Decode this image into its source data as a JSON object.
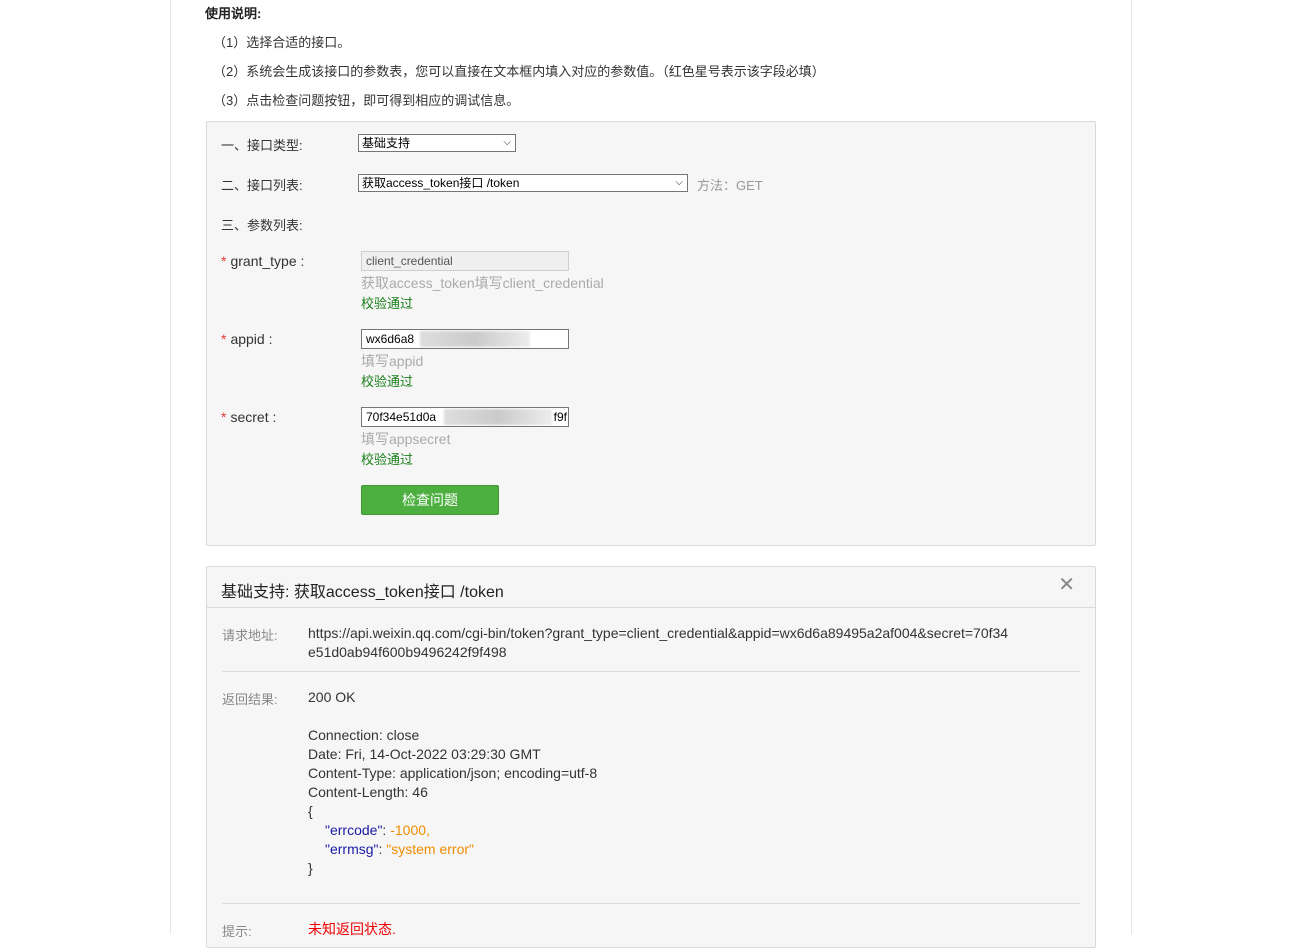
{
  "instructions": {
    "title": "使用说明:",
    "steps": [
      "（1）选择合适的接口。",
      "（2）系统会生成该接口的参数表，您可以直接在文本框内填入对应的参数值。（红色星号表示该字段必填）",
      "（3）点击检查问题按钮，即可得到相应的调试信息。"
    ]
  },
  "form": {
    "interface_type_label": "一、接口类型:",
    "interface_type_value": "基础支持",
    "interface_list_label": "二、接口列表:",
    "interface_list_value": "获取access_token接口 /token",
    "method_text": "方法：GET",
    "params_label": "三、参数列表:",
    "required_mark": "*",
    "params": [
      {
        "name": "grant_type :",
        "value": "client_credential",
        "hint": "获取access_token填写client_credential",
        "status": "校验通过",
        "disabled": true
      },
      {
        "name": "appid :",
        "value": "wx6d6a8",
        "hint": "填写appid",
        "status": "校验通过",
        "disabled": false
      },
      {
        "name": "secret :",
        "value": "70f34e51d0a",
        "value_suffix": "f9f",
        "hint": "填写appsecret",
        "status": "校验通过",
        "disabled": false
      }
    ],
    "check_button": "检查问题"
  },
  "result": {
    "title": "基础支持: 获取access_token接口 /token",
    "close_icon": "close-icon",
    "request_label": "请求地址:",
    "request_url_line1": "https://api.weixin.qq.com/cgi-bin/token?grant_type=client_credential&appid=wx6d6a89495a2af004&secret=70f34",
    "request_url_line2": "e51d0ab94f600b9496242f9f498",
    "response_label": "返回结果:",
    "status": "200 OK",
    "headers": [
      "Connection: close",
      "Date: Fri, 14-Oct-2022 03:29:30 GMT",
      "Content-Type: application/json; encoding=utf-8",
      "Content-Length: 46"
    ],
    "json_open": "{",
    "json_close": "}",
    "errcode_key": "\"errcode\"",
    "errcode_value": "-1000,",
    "errmsg_key": "\"errmsg\"",
    "errmsg_value": "\"system error\"",
    "tip_label": "提示:",
    "tip_text": "未知返回状态."
  },
  "colors": {
    "button_green": "#4caf3f",
    "success_green": "#1a7f1a",
    "required_red": "#e53935",
    "json_key": "#1a1aa6",
    "json_value": "#f08c00",
    "warning": "#e00000"
  }
}
